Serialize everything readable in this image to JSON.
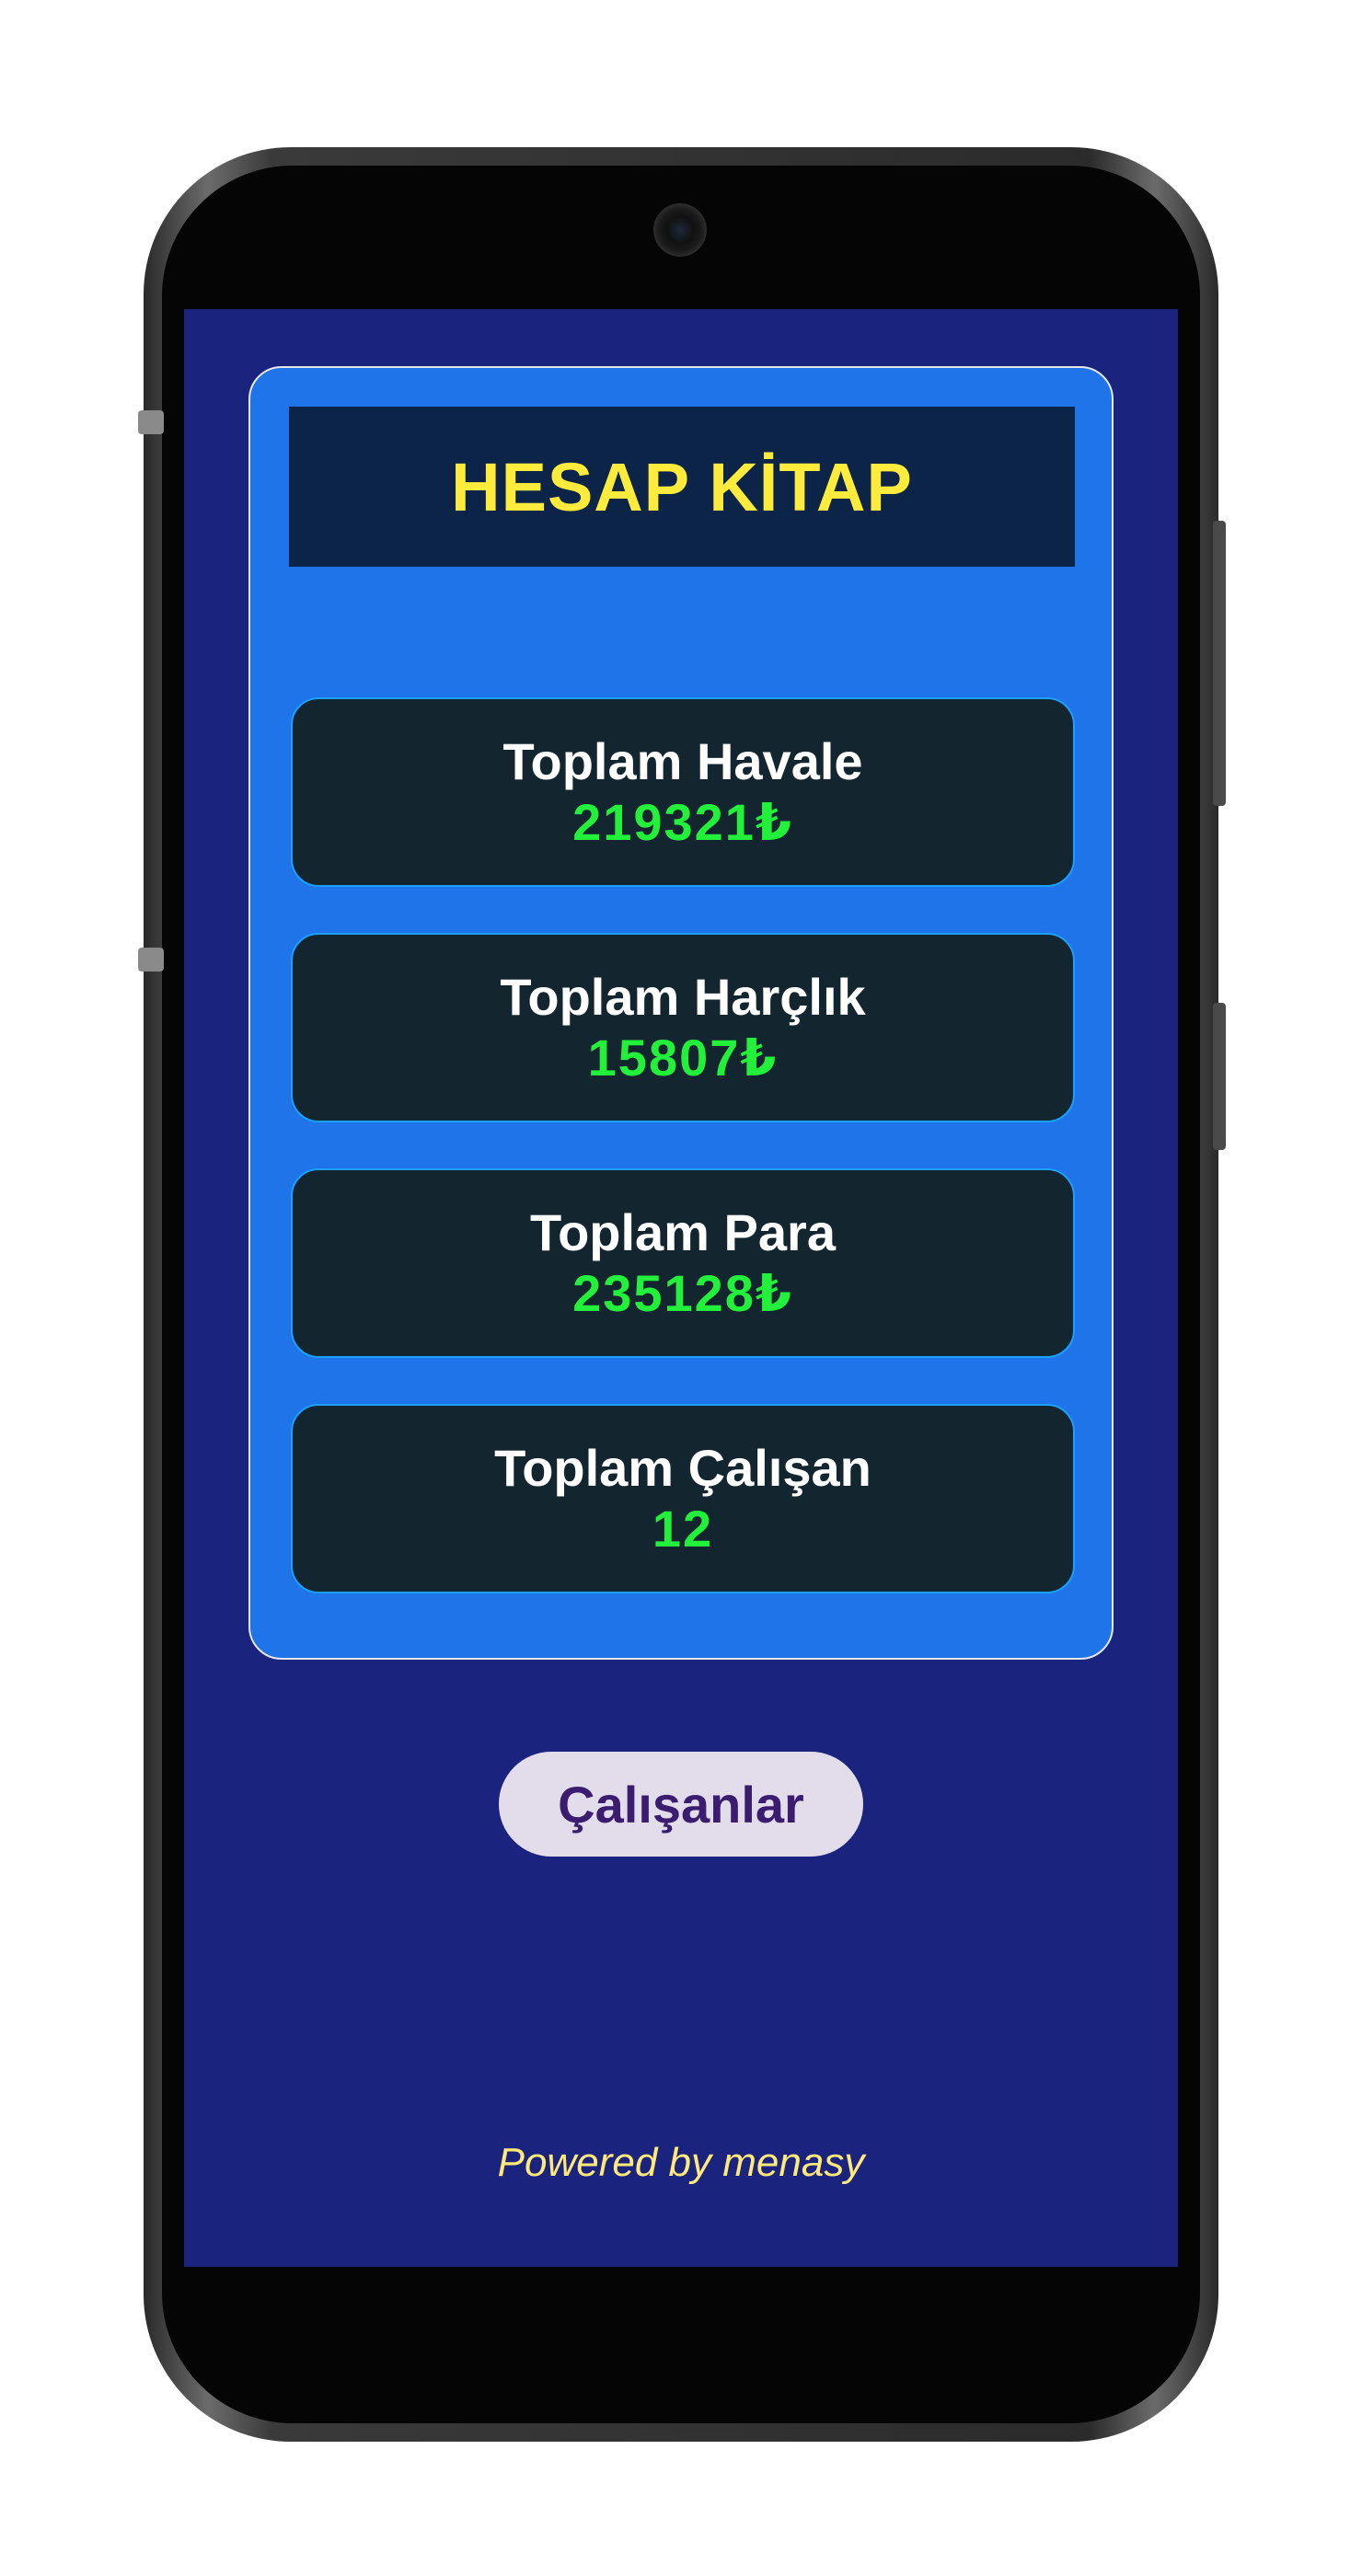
{
  "app": {
    "title": "HESAP KİTAP"
  },
  "stats": [
    {
      "label": "Toplam Havale",
      "value": "219321₺"
    },
    {
      "label": "Toplam Harçlık",
      "value": "15807₺"
    },
    {
      "label": "Toplam Para",
      "value": "235128₺"
    },
    {
      "label": "Toplam Çalışan",
      "value": "12"
    }
  ],
  "actions": {
    "employees_label": "Çalışanlar"
  },
  "footer": {
    "text": "Powered by menasy"
  },
  "colors": {
    "background": "#1a237e",
    "panel": "#1e74e8",
    "title_bar": "#0b2447",
    "title_text": "#ffeb3b",
    "card": "#13262f",
    "value_text": "#22f03a",
    "button_bg": "#e3dcea",
    "button_text": "#3a1d6e",
    "footer_text": "#ffe97a"
  },
  "icons": [
    "front-camera-icon"
  ]
}
